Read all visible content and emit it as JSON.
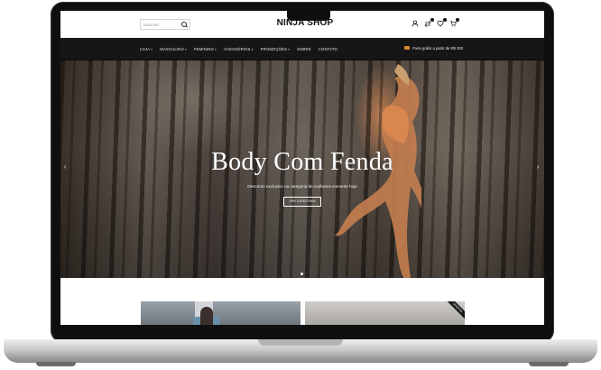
{
  "header": {
    "search_placeholder": "BUSCAR",
    "logo": "NINJA SHOP",
    "icons": [
      "search-icon",
      "user-icon",
      "compare-icon",
      "heart-icon",
      "cart-icon"
    ]
  },
  "nav": {
    "items": [
      {
        "label": "LOJA",
        "has_dropdown": true
      },
      {
        "label": "MASCULINO",
        "has_dropdown": true
      },
      {
        "label": "FEMININO",
        "has_dropdown": true
      },
      {
        "label": "ACESSÓRIOS",
        "has_dropdown": true
      },
      {
        "label": "PROMOÇÕES",
        "has_dropdown": true
      },
      {
        "label": "SOBRE",
        "has_dropdown": false
      },
      {
        "label": "CONTATO",
        "has_dropdown": false
      }
    ],
    "caret": "▾",
    "promo": "Frete grátis a partir de R$ 300"
  },
  "hero": {
    "title": "Body Com Fenda",
    "subtitle": "Desconto exclusivo na categoria de mulheres somente hoje",
    "button_label": "VER CATEGORIA",
    "prev_arrow": "‹",
    "next_arrow": "›"
  },
  "below": {
    "badge": "OFERTA"
  },
  "colors": {
    "nav_bg": "#161616",
    "accent_icon": "#e0872b",
    "frame": "#0f0f0f"
  }
}
